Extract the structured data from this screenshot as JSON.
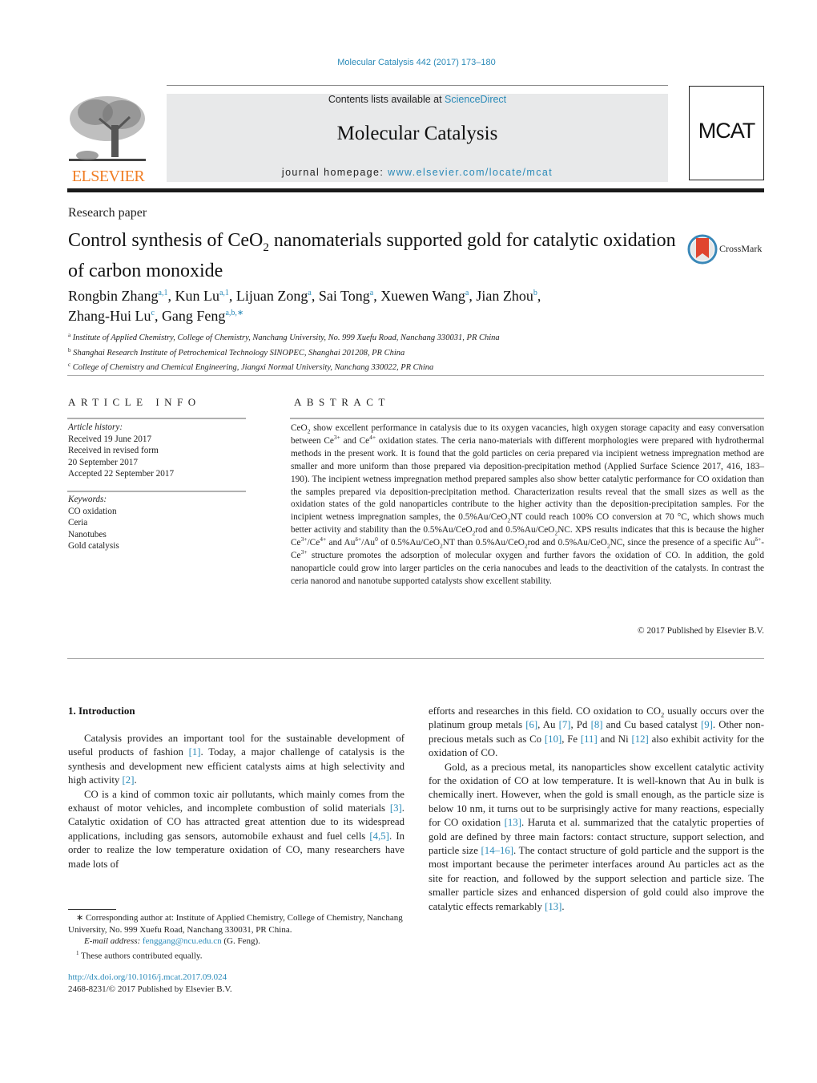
{
  "header": {
    "citation": "Molecular Catalysis 442 (2017) 173–180",
    "contents_prefix": "Contents lists available at ",
    "contents_link": "ScienceDirect",
    "journal_name": "Molecular Catalysis",
    "homepage_prefix": "journal homepage: ",
    "homepage_link": "www.elsevier.com/locate/mcat",
    "publisher_logo": "ELSEVIER",
    "cover_label": "MCAT"
  },
  "article": {
    "type": "Research paper",
    "title_part1": "Control synthesis of CeO",
    "title_sub": "2",
    "title_part2": " nanomaterials supported gold for catalytic oxidation of carbon monoxide",
    "crossmark_label": "CrossMark",
    "authors": [
      {
        "name": "Rongbin Zhang",
        "aff": "a,1"
      },
      {
        "name": "Kun Lu",
        "aff": "a,1"
      },
      {
        "name": "Lijuan Zong",
        "aff": "a"
      },
      {
        "name": "Sai Tong",
        "aff": "a"
      },
      {
        "name": "Xuewen Wang",
        "aff": "a"
      },
      {
        "name": "Jian Zhou",
        "aff": "b"
      },
      {
        "name": "Zhang-Hui Lu",
        "aff": "c"
      },
      {
        "name": "Gang Feng",
        "aff": "a,b,∗"
      }
    ],
    "affiliations": [
      {
        "key": "a",
        "text": "Institute of Applied Chemistry, College of Chemistry, Nanchang University, No. 999 Xuefu Road, Nanchang 330031, PR China"
      },
      {
        "key": "b",
        "text": "Shanghai Research Institute of Petrochemical Technology SINOPEC, Shanghai 201208, PR China"
      },
      {
        "key": "c",
        "text": "College of Chemistry and Chemical Engineering, Jiangxi Normal University, Nanchang 330022, PR China"
      }
    ]
  },
  "article_info": {
    "heading": "ARTICLE INFO",
    "history_label": "Article history:",
    "history": [
      "Received 19 June 2017",
      "Received in revised form",
      "20 September 2017",
      "Accepted 22 September 2017"
    ],
    "keywords_label": "Keywords:",
    "keywords": [
      "CO oxidation",
      "Ceria",
      "Nanotubes",
      "Gold catalysis"
    ]
  },
  "abstract": {
    "heading": "ABSTRACT",
    "t1": "CeO",
    "t2": " show excellent performance in catalysis due to its oxygen vacancies, high oxygen storage capacity and easy conversation between Ce",
    "t3": " and Ce",
    "t4": " oxidation states. The ceria nano-materials with different morphologies were prepared with hydrothermal methods in the present work. It is found that the gold particles on ceria prepared via incipient wetness impregnation method are smaller and more uniform than those prepared via deposition-precipitation method (Applied Surface Science 2017, 416, 183–190). The incipient wetness impregnation method prepared samples also show better catalytic performance for CO oxidation than the samples prepared via deposition-precipitation method. Characterization results reveal that the small sizes as well as the oxidation states of the gold nanoparticles contribute to the higher activity than the deposition-precipitation samples. For the incipient wetness impregnation samples, the 0.5%Au/CeO",
    "t5": "NT could reach 100% CO conversion at 70 °C, which shows much better activity and stability than the 0.5%Au/CeO",
    "t6": "rod and 0.5%Au/CeO",
    "t7": "NC. XPS results indicates that this is because the higher Ce",
    "t8": "/Ce",
    "t9": " and Au",
    "t10": "/Au",
    "t11": " of 0.5%Au/CeO",
    "t12": "NT than 0.5%Au/CeO",
    "t13": "rod and 0.5%Au/CeO",
    "t14": "NC, since the presence of a specific Au",
    "t15": "-Ce",
    "t16": " structure promotes the adsorption of molecular oxygen and further favors the oxidation of CO. In addition, the gold nanoparticle could grow into larger particles on the ceria nanocubes and leads to the deactivition of the catalysts. In contrast the ceria nanorod and nanotube supported catalysts show excellent stability.",
    "sub2": "2",
    "sup3": "3+",
    "sup4": "4+",
    "supd": "δ+",
    "sup0": "0",
    "copyright": "© 2017 Published by Elsevier B.V."
  },
  "intro": {
    "heading": "1.  Introduction",
    "p1a": "Catalysis provides an important tool for the sustainable development of useful products of fashion ",
    "r1": "[1]",
    "p1b": ". Today, a major challenge of catalysis is the synthesis and development new efficient catalysts aims at high selectivity and high activity ",
    "r2": "[2]",
    "p1c": ".",
    "p2a": "CO is a kind of common toxic air pollutants, which mainly comes from the exhaust of motor vehicles, and incomplete combustion of solid materials ",
    "r3": "[3]",
    "p2b": ". Catalytic oxidation of CO has attracted great attention due to its widespread applications, including gas sensors, automobile exhaust and fuel cells ",
    "r45": "[4,5]",
    "p2c": ". In order to realize the low temperature oxidation of CO, many researchers have made lots of",
    "p3a": "efforts and researches in this field. CO oxidation to CO",
    "p3sub": "2",
    "p3b": " usually occurs over the platinum group metals ",
    "r6": "[6]",
    "p3c": ", Au ",
    "r7": "[7]",
    "p3d": ", Pd ",
    "r8": "[8]",
    "p3e": " and Cu based catalyst ",
    "r9": "[9]",
    "p3f": ". Other non-precious metals such as Co ",
    "r10": "[10]",
    "p3g": ", Fe ",
    "r11": "[11]",
    "p3h": " and Ni ",
    "r12": "[12]",
    "p3i": " also exhibit activity for the oxidation of CO.",
    "p4a": "Gold, as a precious metal, its nanoparticles show excellent catalytic activity for the oxidation of CO at low temperature. It is well-known that Au in bulk is chemically inert. However, when the gold is small enough, as the particle size is below 10 nm, it turns out to be surprisingly active for many reactions, especially for CO oxidation ",
    "r13": "[13]",
    "p4b": ". Haruta et al. summarized that the catalytic properties of gold are defined by three main factors: contact structure, support selection, and particle size ",
    "r1416": "[14–16]",
    "p4c": ". The contact structure of gold particle and the support is the most important because the perimeter interfaces around Au particles act as the site for reaction, and followed by the support selection and particle size. The smaller particle sizes and enhanced dispersion of gold could also improve the catalytic effects remarkably ",
    "r13b": "[13]",
    "p4d": "."
  },
  "footnotes": {
    "corr_mark": "∗",
    "corr": " Corresponding author at: Institute of Applied Chemistry, College of Chemistry, Nanchang University, No. 999 Xuefu Road, Nanchang 330031, PR China.",
    "email_label": "E-mail address: ",
    "email": "fenggang@ncu.edu.cn",
    "email_suffix": " (G. Feng).",
    "eq_mark": "1",
    "eq": " These authors contributed equally.",
    "doi": "http://dx.doi.org/10.1016/j.mcat.2017.09.024",
    "issn": "2468-8231/© 2017 Published by Elsevier B.V."
  }
}
